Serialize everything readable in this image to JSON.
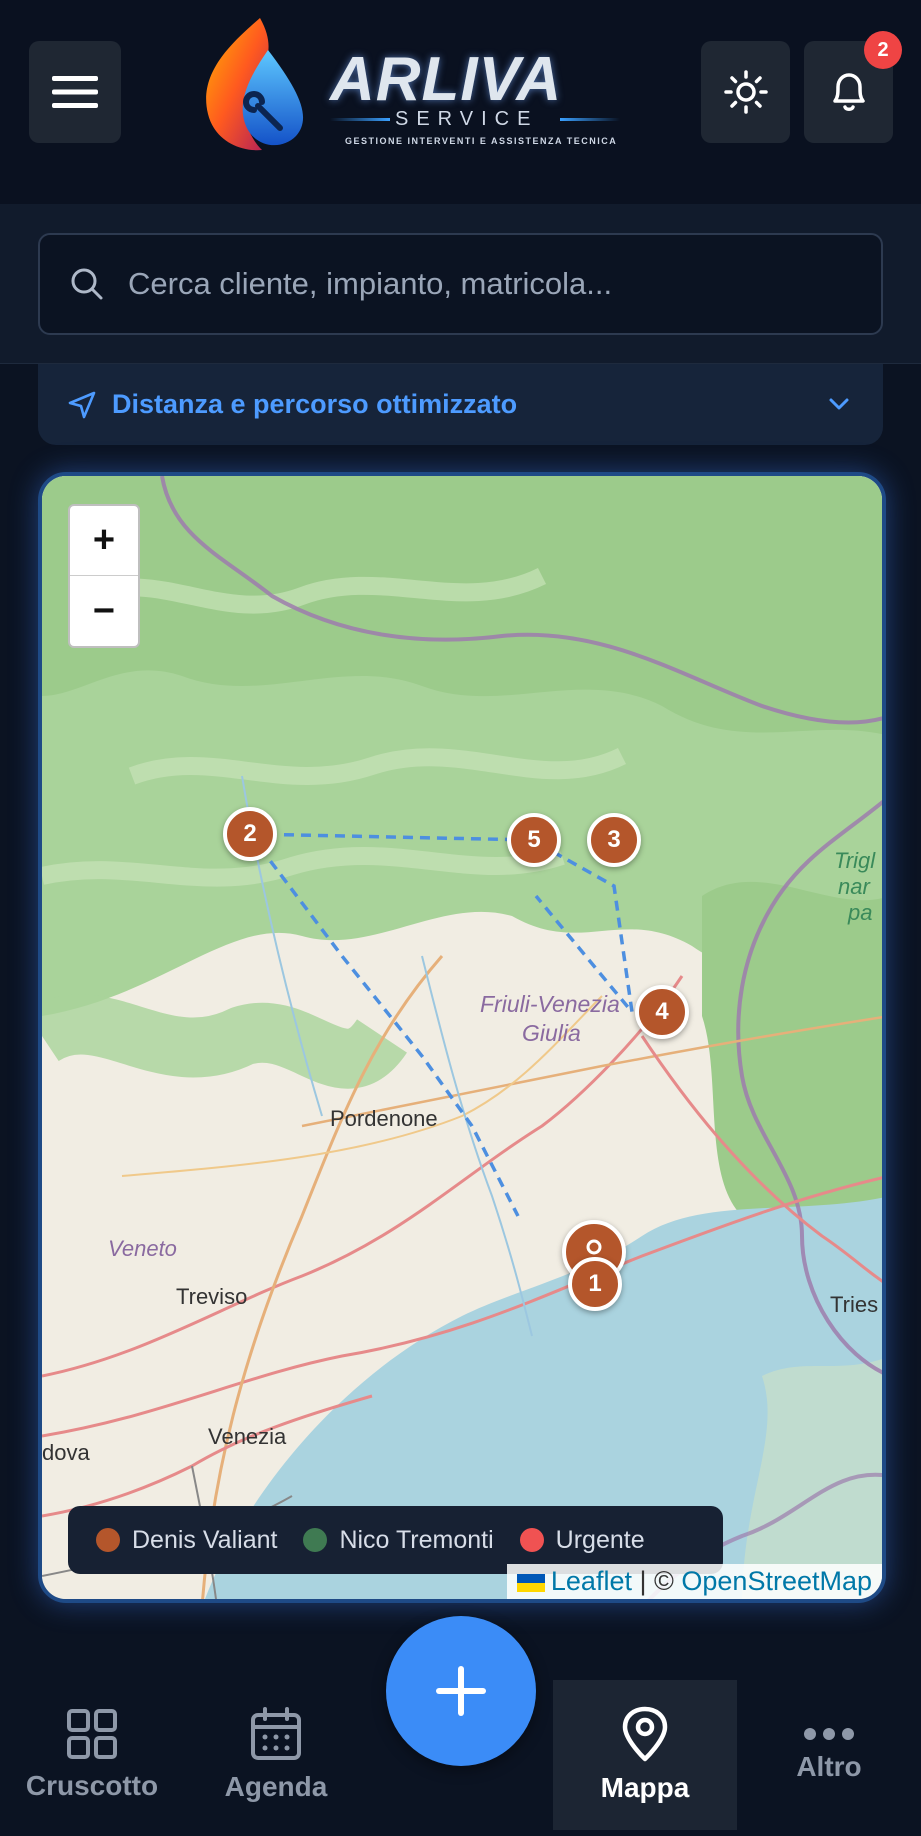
{
  "header": {
    "logo_title": "ARLIVA",
    "logo_subtitle": "SERVICE",
    "logo_tagline": "GESTIONE INTERVENTI E ASSISTENZA TECNICA",
    "notification_count": "2"
  },
  "search": {
    "placeholder": "Cerca cliente, impianto, matricola..."
  },
  "route_panel": {
    "label": "Distanza e percorso ottimizzato"
  },
  "map": {
    "zoom_in": "+",
    "zoom_out": "−",
    "places": {
      "region": "Friuli-Venezia",
      "region2": "Giulia",
      "pordenone": "Pordenone",
      "veneto": "Veneto",
      "treviso": "Treviso",
      "venezia": "Venezia",
      "dova": "dova",
      "tries": "Tries",
      "trigl": "Trigl",
      "nar": "nar",
      "pa": "pa"
    },
    "markers": [
      "1",
      "2",
      "3",
      "4",
      "5"
    ],
    "legend": [
      {
        "label": "Denis Valiant",
        "color": "#b4562b"
      },
      {
        "label": "Nico Tremonti",
        "color": "#3f7a52"
      },
      {
        "label": "Urgente",
        "color": "#f05252"
      }
    ],
    "attribution_leaflet": "Leaflet",
    "attribution_sep": " | © ",
    "attribution_osm": "OpenStreetMap"
  },
  "nav": {
    "items": [
      {
        "label": "Cruscotto",
        "icon": "grid-icon"
      },
      {
        "label": "Agenda",
        "icon": "calendar-icon"
      },
      {
        "label": "Mappa",
        "icon": "map-pin-icon",
        "active": true
      },
      {
        "label": "Altro",
        "icon": "more-icon"
      }
    ]
  }
}
